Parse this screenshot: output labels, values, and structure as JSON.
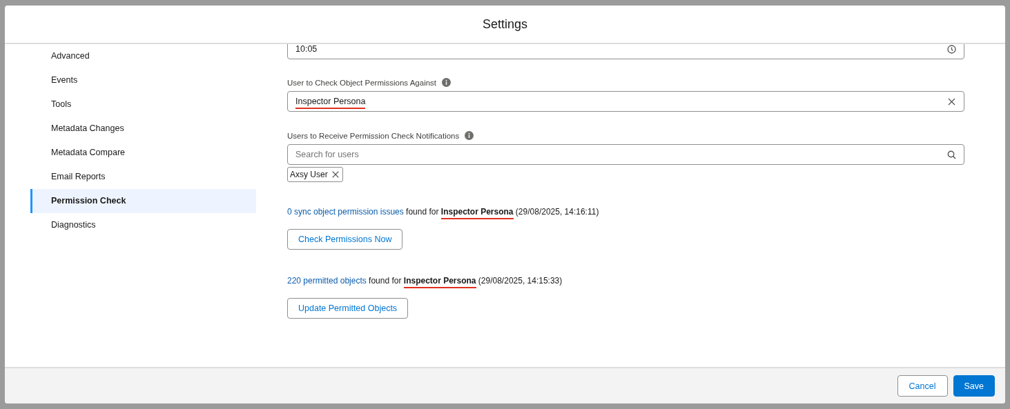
{
  "modal": {
    "title": "Settings"
  },
  "sidebar": {
    "items": [
      {
        "label": "Advanced",
        "selected": false
      },
      {
        "label": "Events",
        "selected": false
      },
      {
        "label": "Tools",
        "selected": false
      },
      {
        "label": "Metadata Changes",
        "selected": false
      },
      {
        "label": "Metadata Compare",
        "selected": false
      },
      {
        "label": "Email Reports",
        "selected": false
      },
      {
        "label": "Permission Check",
        "selected": true
      },
      {
        "label": "Diagnostics",
        "selected": false
      }
    ]
  },
  "time_field": {
    "value": "10:05"
  },
  "user_field": {
    "label": "User to Check Object Permissions Against",
    "value": "Inspector Persona",
    "underlined": true
  },
  "notify_field": {
    "label": "Users to Receive Permission Check Notifications",
    "placeholder": "Search for users",
    "pills": [
      "Axsy User"
    ]
  },
  "results": [
    {
      "link": "0 sync object permission issues",
      "middle": "found for",
      "persona": "Inspector Persona",
      "underlined": true,
      "timestamp": "(29/08/2025, 14:16:11)",
      "button": "Check Permissions Now"
    },
    {
      "link": "220 permitted objects",
      "middle": "found for",
      "persona": "Inspector Persona",
      "underlined": true,
      "timestamp": "(29/08/2025, 14:15:33)",
      "button": "Update Permitted Objects"
    }
  ],
  "footer": {
    "buttons": [
      {
        "label": "Cancel",
        "kind": "neutral"
      },
      {
        "label": "Save",
        "kind": "brand"
      }
    ]
  }
}
